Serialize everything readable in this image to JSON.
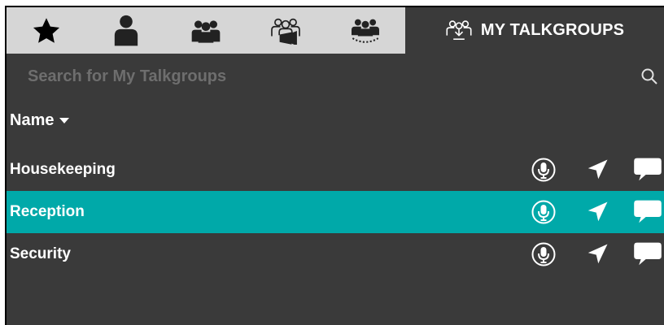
{
  "tabs": [
    {
      "icon": "star-icon"
    },
    {
      "icon": "user-icon"
    },
    {
      "icon": "group-icon"
    },
    {
      "icon": "broadcast-group-icon"
    },
    {
      "icon": "dynamic-group-icon"
    },
    {
      "icon": "my-talkgroups-icon",
      "label": "MY TALKGROUPS"
    }
  ],
  "search": {
    "placeholder": "Search for My Talkgroups",
    "value": ""
  },
  "column_header": {
    "label": "Name"
  },
  "rows": [
    {
      "name": "Housekeeping"
    },
    {
      "name": "Reception"
    },
    {
      "name": "Security"
    }
  ],
  "row_actions": [
    "microphone-icon",
    "location-arrow-icon",
    "message-icon"
  ],
  "colors": {
    "background": "#3a3a3a",
    "tabbar": "#d6d6d6",
    "selected_row": "#00a9a9",
    "placeholder": "#6e6e6e"
  }
}
